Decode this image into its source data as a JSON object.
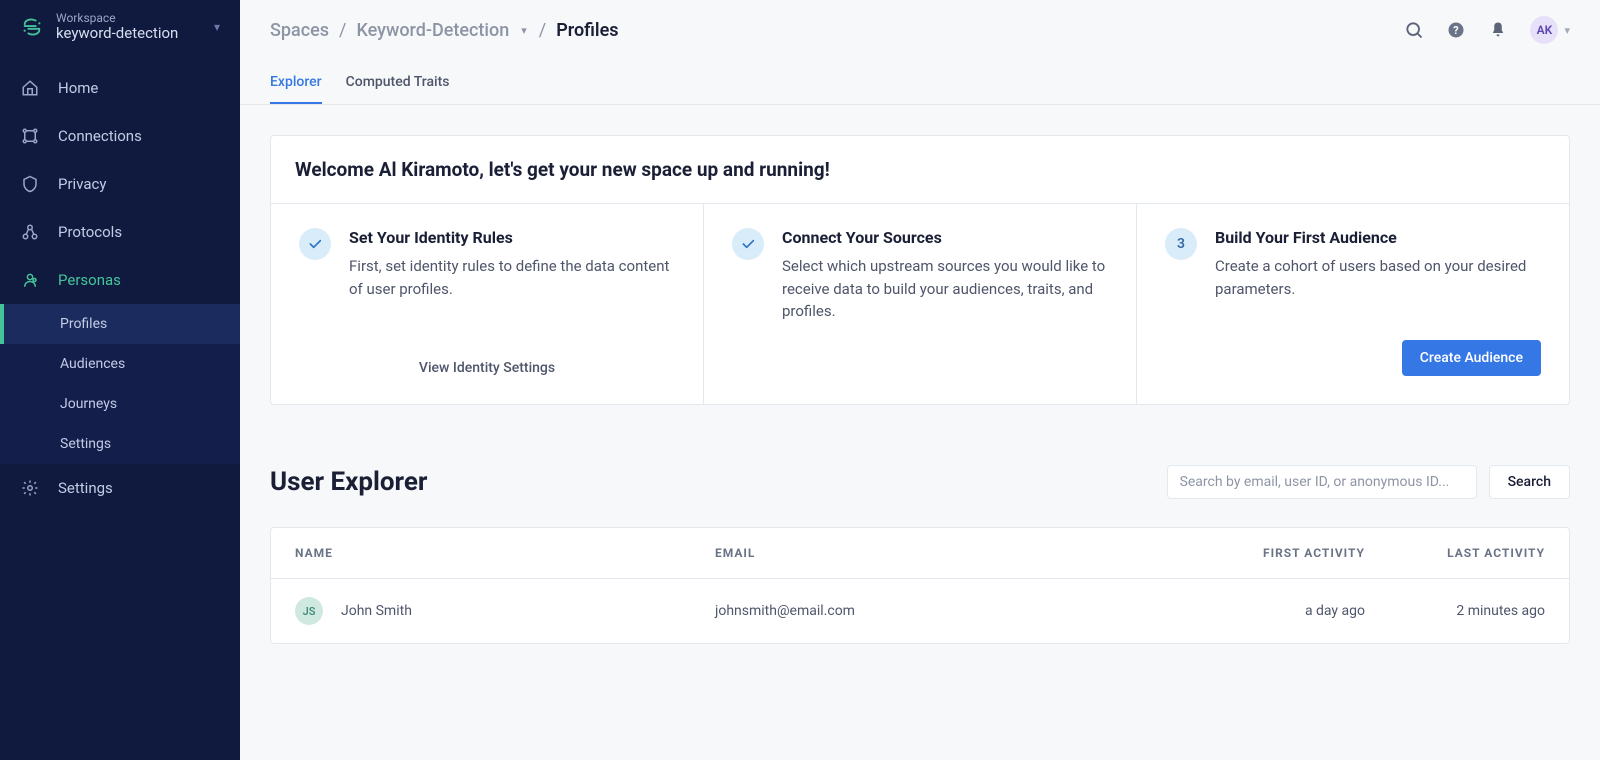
{
  "workspace": {
    "label": "Workspace",
    "name": "keyword-detection"
  },
  "sidebar": {
    "items": [
      {
        "label": "Home"
      },
      {
        "label": "Connections"
      },
      {
        "label": "Privacy"
      },
      {
        "label": "Protocols"
      },
      {
        "label": "Personas"
      },
      {
        "label": "Settings"
      }
    ],
    "subitems": [
      {
        "label": "Profiles"
      },
      {
        "label": "Audiences"
      },
      {
        "label": "Journeys"
      },
      {
        "label": "Settings"
      }
    ]
  },
  "breadcrumb": {
    "spaces": "Spaces",
    "space": "Keyword-Detection",
    "current": "Profiles"
  },
  "header": {
    "avatar_initials": "AK"
  },
  "tabs": [
    {
      "label": "Explorer"
    },
    {
      "label": "Computed Traits"
    }
  ],
  "welcome": {
    "title": "Welcome Al Kiramoto, let's get your new space up and running!",
    "steps": [
      {
        "title": "Set Your Identity Rules",
        "desc": "First, set identity rules to define the data content of user profiles.",
        "footer_label": "View Identity Settings"
      },
      {
        "title": "Connect Your Sources",
        "desc": "Select which upstream sources you would like to receive data to build your audiences, traits, and profiles."
      },
      {
        "title": "Build Your First Audience",
        "desc": "Create a cohort of users based on your desired parameters.",
        "footer_label": "Create Audience",
        "badge_num": "3"
      }
    ]
  },
  "explorer": {
    "title": "User Explorer",
    "search_placeholder": "Search by email, user ID, or anonymous ID...",
    "search_btn": "Search"
  },
  "table": {
    "headers": {
      "name": "NAME",
      "email": "EMAIL",
      "first": "FIRST ACTIVITY",
      "last": "LAST ACTIVITY"
    },
    "rows": [
      {
        "initials": "JS",
        "name": "John Smith",
        "email": "johnsmith@email.com",
        "first": "a day ago",
        "last": "2 minutes ago"
      }
    ]
  }
}
